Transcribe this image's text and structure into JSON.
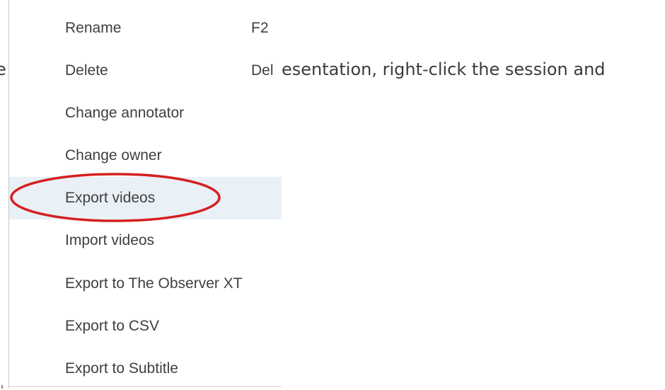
{
  "background": {
    "text_left": "e",
    "text_right": "esentation, right-click the session and"
  },
  "context_menu": {
    "items": [
      {
        "label": "Rename",
        "shortcut": "F2"
      },
      {
        "label": "Delete",
        "shortcut": "Del"
      },
      {
        "label": "Change annotator",
        "shortcut": ""
      },
      {
        "label": "Change owner",
        "shortcut": ""
      },
      {
        "label": "Export videos",
        "shortcut": "",
        "highlighted": true
      },
      {
        "label": "Import videos",
        "shortcut": ""
      },
      {
        "label": "Export to The Observer XT",
        "shortcut": ""
      },
      {
        "label": "Export to CSV",
        "shortcut": ""
      },
      {
        "label": "Export to Subtitle",
        "shortcut": ""
      }
    ]
  },
  "colors": {
    "highlight": "#e9f0f6",
    "annotation_circle": "#d42020",
    "text": "#3f3f3f"
  }
}
